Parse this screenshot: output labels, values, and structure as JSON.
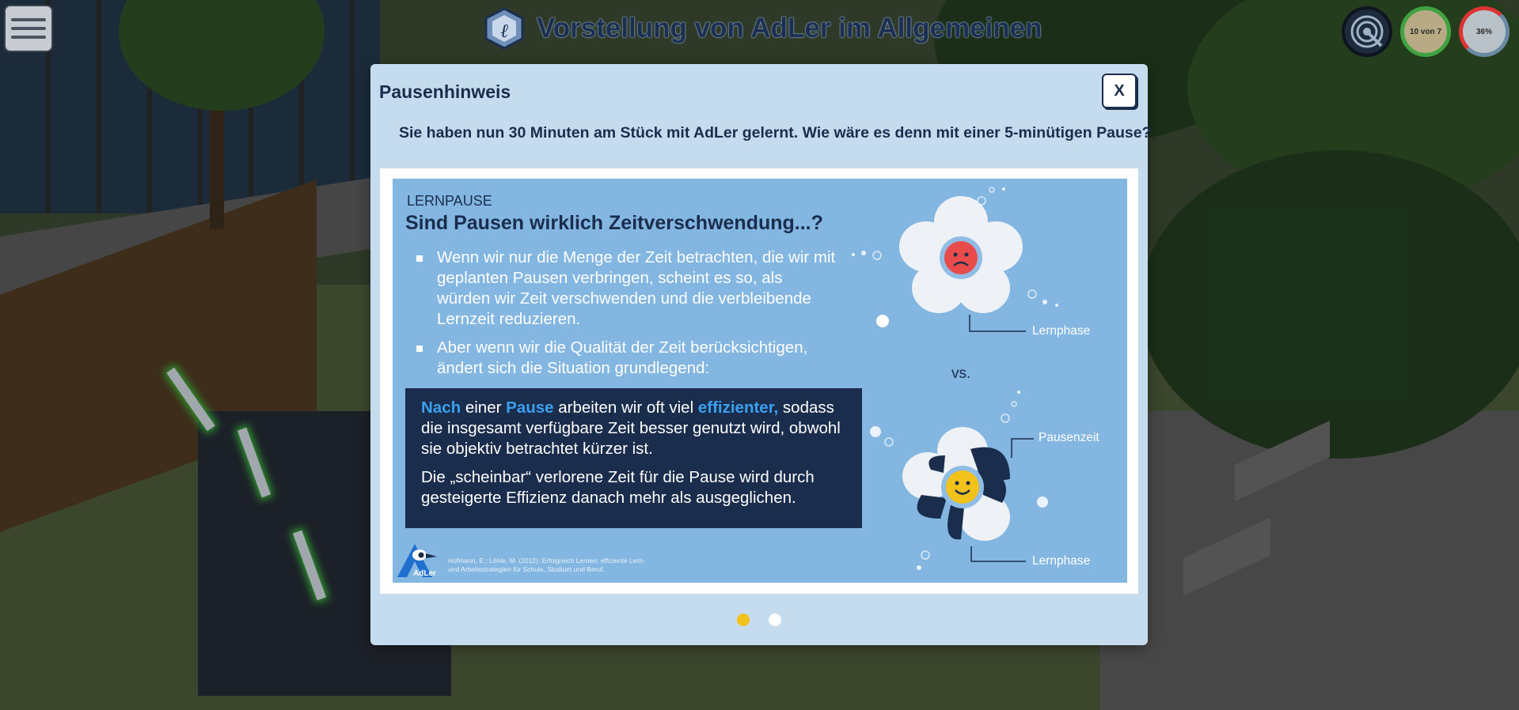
{
  "header": {
    "title": "Vorstellung von AdLer im Allgemeinen",
    "menu_icon": "hamburger-menu-icon",
    "space_icon": "learning-space-icon"
  },
  "hud": {
    "target_icon": "target-icon",
    "progress_rooms": "10 von 7",
    "progress_percent": "36%"
  },
  "modal": {
    "title": "Pausenhinweis",
    "close_label": "X",
    "message": "Sie haben nun 30 Minuten am Stück mit AdLer gelernt. Wie wäre es denn mit einer 5-minütigen Pause?"
  },
  "slide": {
    "kicker": "LERNPAUSE",
    "heading": "Sind Pausen wirklich Zeitverschwendung...?",
    "bullets": [
      "Wenn wir nur die Menge der Zeit betrachten, die wir mit geplanten Pausen verbringen, scheint es so, als würden wir Zeit verschwenden und die verbleibende Lernzeit reduzieren.",
      "Aber wenn wir die Qualität der Zeit berücksichtigen, ändert sich die Situation grundlegend:"
    ],
    "box": {
      "p1_word1": "Nach",
      "p1_text1": " einer ",
      "p1_word2": "Pause",
      "p1_text2": " arbeiten wir oft viel ",
      "p1_word3": "effizienter,",
      "p1_text3": " sodass die insgesamt verfügbare Zeit besser genutzt wird, obwohl sie objektiv betrachtet kürzer ist.",
      "p2": "Die „scheinbar“ verlorene Zeit für die Pause wird durch gesteigerte Effizienz danach mehr als ausgeglichen."
    },
    "vs": "vs.",
    "label_top": "Lernphase",
    "label_pause": "Pausenzeit",
    "label_bottom": "Lernphase",
    "logo_text": "AdLer",
    "citation": "Hofmann, E.; Löhle, M. (2012): Erfolgreich Lernen: effiziente Lern- und Arbeitsstrategien für Schule, Studium und Beruf."
  },
  "pagination": {
    "pages": 2,
    "active": 1
  },
  "colors": {
    "accent": "#f2c21b",
    "highlight": "#3aa0f0",
    "dark": "#1b2d4d",
    "slide_bg": "#83b6e0",
    "modal_bg": "#c5dcef"
  }
}
